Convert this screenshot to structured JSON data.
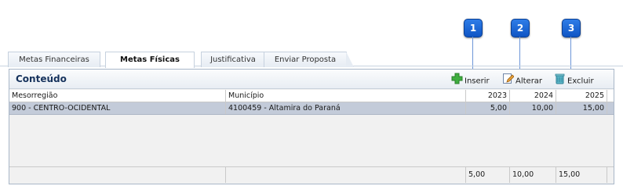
{
  "callouts": [
    "1",
    "2",
    "3"
  ],
  "tabs": [
    {
      "label": "Metas Financeiras",
      "active": false
    },
    {
      "label": "Metas Físicas",
      "active": true
    },
    {
      "label": "Justificativa",
      "active": false
    },
    {
      "label": "Enviar Proposta",
      "active": false
    }
  ],
  "panel": {
    "title": "Conteúdo",
    "toolbar": {
      "insert": {
        "label": "Inserir",
        "icon": "plus-icon"
      },
      "edit": {
        "label": "Alterar",
        "icon": "edit-icon"
      },
      "delete": {
        "label": "Excluir",
        "icon": "trash-icon"
      }
    }
  },
  "grid": {
    "columns": [
      "Mesorregião",
      "Município",
      "2023",
      "2024",
      "2025"
    ],
    "rows": [
      [
        "900 - CENTRO-OCIDENTAL",
        "4100459 - Altamira do Paraná",
        "5,00",
        "10,00",
        "15,00"
      ]
    ],
    "totals": [
      "",
      "",
      "5,00",
      "10,00",
      "15,00"
    ]
  },
  "colors": {
    "accent": "#1f6fe0",
    "selected_row": "#c3cbd9",
    "title": "#16325c"
  }
}
